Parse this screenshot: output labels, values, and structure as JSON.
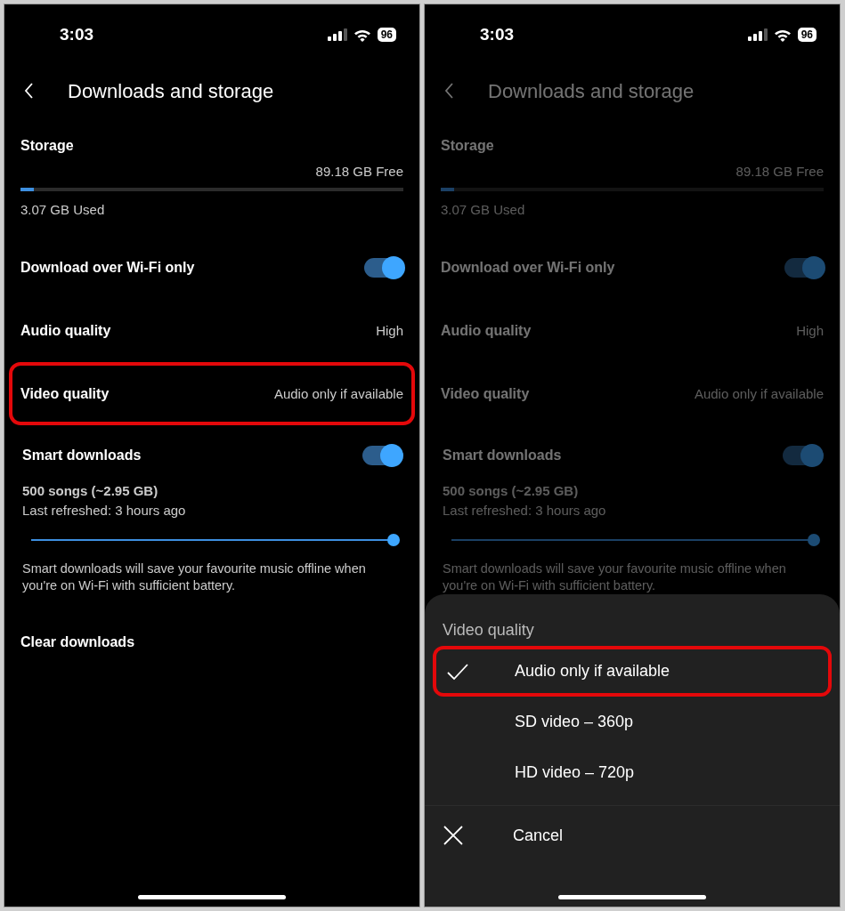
{
  "screens": [
    {
      "dimmed": false,
      "status_bar": {
        "time": "3:03",
        "battery": "96"
      },
      "title": "Downloads and storage",
      "storage": {
        "label": "Storage",
        "free": "89.18 GB Free",
        "level": 0.034,
        "used": "3.07 GB Used"
      },
      "settings": [
        {
          "kind": "toggle",
          "label": "Download over Wi-Fi only",
          "on": true,
          "highlighted": false
        },
        {
          "kind": "value",
          "label": "Audio quality",
          "value": "High",
          "highlighted": false
        },
        {
          "kind": "value",
          "label": "Video quality",
          "value": "Audio only if available",
          "highlighted": true
        }
      ],
      "smart_downloads": {
        "label": "Smart downloads",
        "on": true,
        "summary": "500 songs (~2.95 GB)",
        "refreshed": "Last refreshed: 3 hours ago",
        "level": 1,
        "description": "Smart downloads will save your favourite music offline when you're on Wi-Fi with sufficient battery."
      },
      "clear_downloads": "Clear downloads"
    },
    {
      "dimmed": true,
      "status_bar": {
        "time": "3:03",
        "battery": "96"
      },
      "title": "Downloads and storage",
      "storage": {
        "label": "Storage",
        "free": "89.18 GB Free",
        "level": 0.034,
        "used": "3.07 GB Used"
      },
      "settings": [
        {
          "kind": "toggle",
          "label": "Download over Wi-Fi only",
          "on": true,
          "highlighted": false
        },
        {
          "kind": "value",
          "label": "Audio quality",
          "value": "High",
          "highlighted": false
        },
        {
          "kind": "value",
          "label": "Video quality",
          "value": "Audio only if available",
          "highlighted": false
        }
      ],
      "smart_downloads": {
        "label": "Smart downloads",
        "on": true,
        "summary": "500 songs (~2.95 GB)",
        "refreshed": "Last refreshed: 3 hours ago",
        "level": 1,
        "description": "Smart downloads will save your favourite music offline when you're on Wi-Fi with sufficient battery."
      },
      "sheet": {
        "title": "Video quality",
        "options": [
          {
            "label": "Audio only if available",
            "selected": true,
            "highlighted": true
          },
          {
            "label": "SD video – 360p",
            "selected": false,
            "highlighted": false
          },
          {
            "label": "HD video – 720p",
            "selected": false,
            "highlighted": false
          }
        ],
        "cancel": "Cancel"
      }
    }
  ]
}
